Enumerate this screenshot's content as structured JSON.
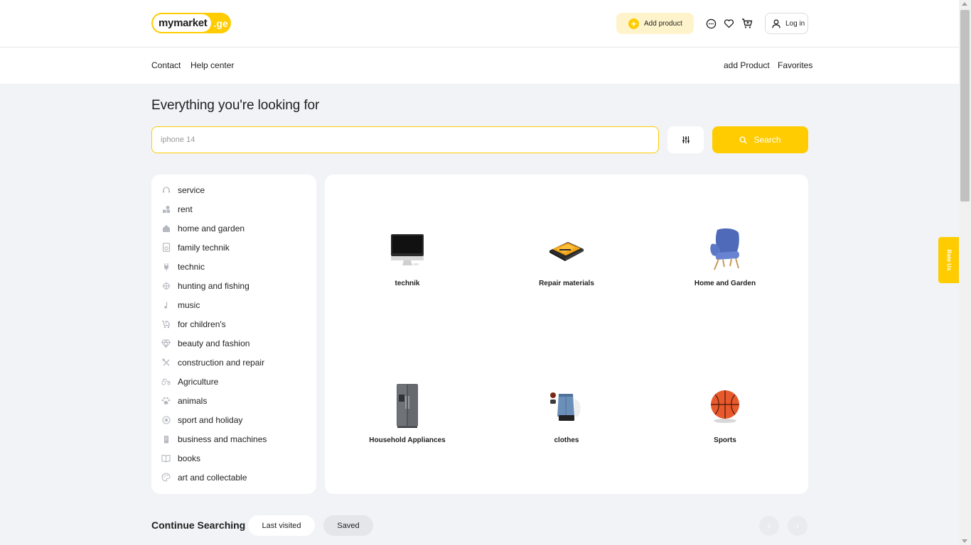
{
  "header": {
    "logo_main": "mymarket",
    "logo_suffix": ".ge",
    "add_product_label": "Add product",
    "login_label": "Log in"
  },
  "nav": {
    "contact": "Contact",
    "help_center": "Help center",
    "add_product": "add Product",
    "favorites": "Favorites"
  },
  "rate_us": "Rate Us",
  "hero": {
    "title": "Everything you're looking for",
    "search_placeholder": "iphone 14",
    "search_button": "Search"
  },
  "categories": [
    {
      "label": "service",
      "icon": "headset-icon"
    },
    {
      "label": "rent",
      "icon": "shapes-icon"
    },
    {
      "label": "home and garden",
      "icon": "house-icon"
    },
    {
      "label": "family technik",
      "icon": "fridge-icon"
    },
    {
      "label": "technic",
      "icon": "plug-icon"
    },
    {
      "label": "hunting and fishing",
      "icon": "crosshair-icon"
    },
    {
      "label": "music",
      "icon": "music-note-icon"
    },
    {
      "label": "for children's",
      "icon": "stroller-icon"
    },
    {
      "label": "beauty and fashion",
      "icon": "diamond-icon"
    },
    {
      "label": "construction and repair",
      "icon": "tools-icon"
    },
    {
      "label": "Agriculture",
      "icon": "tractor-icon"
    },
    {
      "label": "animals",
      "icon": "paw-icon"
    },
    {
      "label": "sport and holiday",
      "icon": "ball-icon"
    },
    {
      "label": "business and machines",
      "icon": "building-icon"
    },
    {
      "label": "books",
      "icon": "book-icon"
    },
    {
      "label": "art and collectable",
      "icon": "palette-icon"
    }
  ],
  "tiles": [
    {
      "label": "technik",
      "image": "imac-image"
    },
    {
      "label": "Repair materials",
      "image": "tool-kit-image"
    },
    {
      "label": "Home and Garden",
      "image": "armchair-image"
    },
    {
      "label": "Household Appliances",
      "image": "refrigerator-image"
    },
    {
      "label": "clothes",
      "image": "clothes-image"
    },
    {
      "label": "Sports",
      "image": "basketball-image"
    }
  ],
  "continue": {
    "title": "Continue Searching",
    "last_visited": "Last visited",
    "saved": "Saved"
  },
  "colors": {
    "brand_yellow": "#fecc00",
    "brand_yellow_light": "#fff3cc",
    "page_background": "#f1f3f6"
  }
}
